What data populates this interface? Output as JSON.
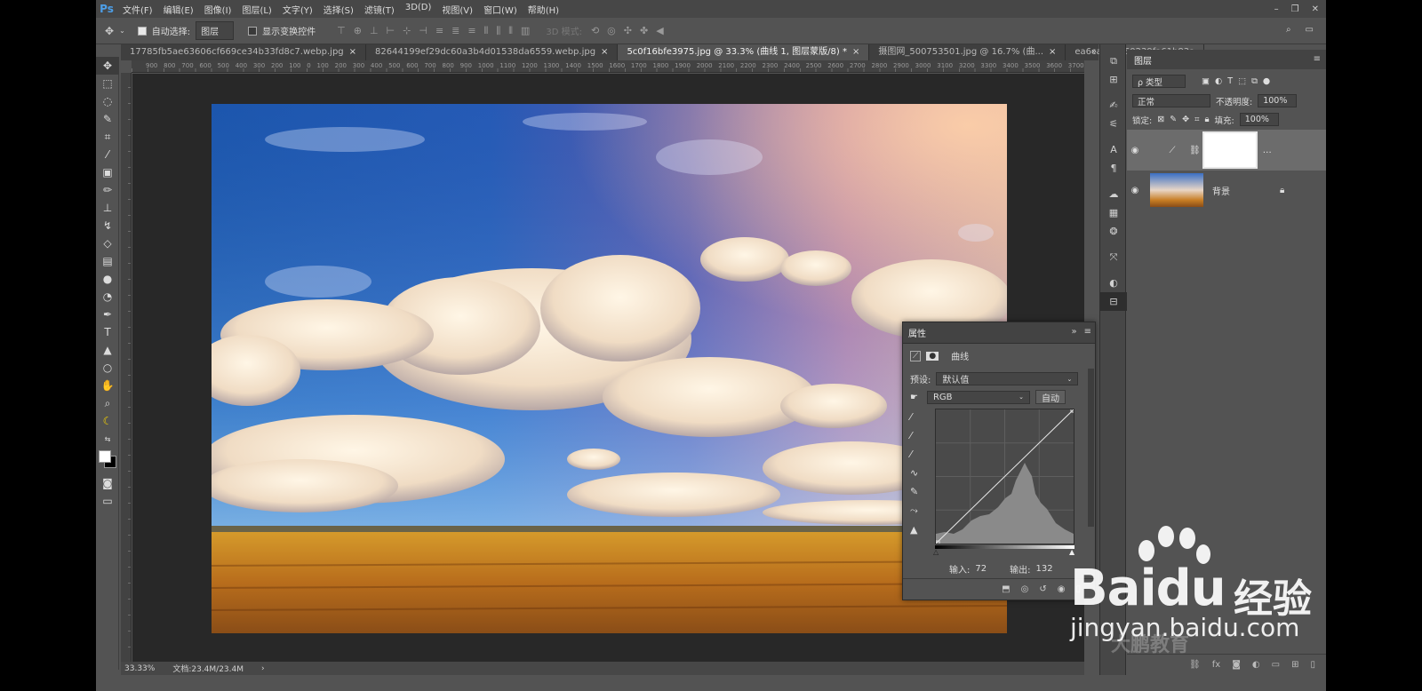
{
  "app": {
    "logo": "Ps",
    "name": "Photoshop"
  },
  "menu": [
    "文件(F)",
    "编辑(E)",
    "图像(I)",
    "图层(L)",
    "文字(Y)",
    "选择(S)",
    "滤镜(T)",
    "3D(D)",
    "视图(V)",
    "窗口(W)",
    "帮助(H)"
  ],
  "window_controls": [
    "–",
    "❐",
    "✕"
  ],
  "options": {
    "auto_select_label": "自动选择:",
    "auto_select_value": "图层",
    "transform_label": "显示变换控件",
    "mode3d_label": "3D 模式:"
  },
  "tabs": [
    {
      "label": "17785fb5ae63606cf669ce34b33fd8c7.webp.jpg",
      "active": false
    },
    {
      "label": "82644199ef29dc60a3b4d01538da6559.webp.jpg",
      "active": false
    },
    {
      "label": "5c0f16bfe3975.jpg @ 33.3% (曲线 1, 图层蒙版/8) *",
      "active": true
    },
    {
      "label": "摄图网_500753501.jpg @ 16.7% (曲...",
      "active": false
    },
    {
      "label": "ea6ca3e3960239fa61b83a",
      "active": false
    }
  ],
  "ruler_labels": [
    "900",
    "800",
    "700",
    "600",
    "500",
    "400",
    "300",
    "200",
    "100",
    "0",
    "100",
    "200",
    "300",
    "400",
    "500",
    "600",
    "700",
    "800",
    "900",
    "1000",
    "1100",
    "1200",
    "1300",
    "1400",
    "1500",
    "1600",
    "1700",
    "1800",
    "1900",
    "2000",
    "2100",
    "2200",
    "2300",
    "2400",
    "2500",
    "2600",
    "2700",
    "2800",
    "2900",
    "3000",
    "3100",
    "3200",
    "3300",
    "3400",
    "3500",
    "3600",
    "3700"
  ],
  "status": {
    "zoom": "33.33%",
    "doc": "文档:23.4M/23.4M"
  },
  "properties": {
    "title": "属性",
    "adj_name": "曲线",
    "preset_label": "预设:",
    "preset_value": "默认值",
    "channel": "RGB",
    "auto_button": "自动",
    "input_label": "输入:",
    "input_value": "72",
    "output_label": "输出:",
    "output_value": "132"
  },
  "layers_panel": {
    "title": "图层",
    "filter_label": "ρ 类型",
    "blend_mode": "正常",
    "opacity_label": "不透明度:",
    "opacity_value": "100%",
    "lock_label": "锁定:",
    "fill_label": "填充:",
    "fill_value": "100%",
    "layers": [
      {
        "name": "",
        "kind": "curves-adjustment",
        "selected": true
      },
      {
        "name": "背景",
        "kind": "image",
        "locked": true
      }
    ]
  },
  "watermark": {
    "logo_text": "Baidu",
    "cn": "经验",
    "url": "jingyan.baidu.com",
    "sub": "大鹏教育"
  },
  "colors": {
    "ps_blue": "#4d9fe8",
    "panel": "#535353",
    "canvas_bg": "#282828"
  }
}
